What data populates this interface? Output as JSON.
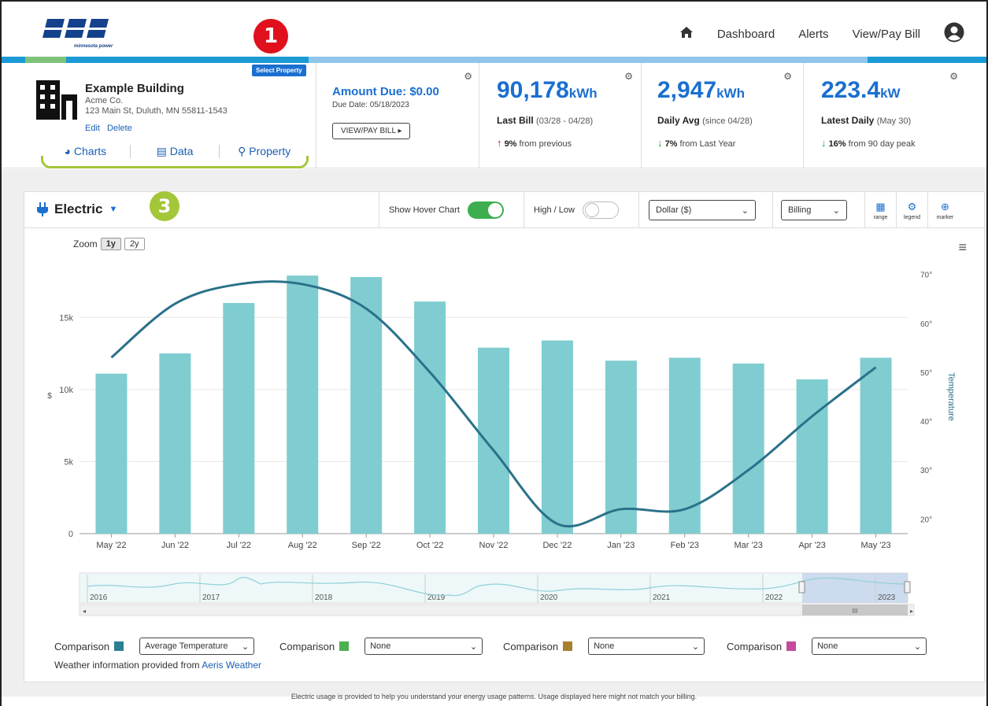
{
  "brand": {
    "logo_text": "minnesota power",
    "accent": "#1a6fd0",
    "callout_red": "#e0101d",
    "callout_green": "#a4c639"
  },
  "nav": {
    "home_icon": "home-icon",
    "items": [
      "Dashboard",
      "Alerts",
      "View/Pay Bill"
    ],
    "profile_icon": "user-circle-icon"
  },
  "callouts": {
    "one": "1",
    "three": "3"
  },
  "property": {
    "select_label": "Select Property",
    "name": "Example Building",
    "company": "Acme Co.",
    "address": "123 Main St, Duluth, MN 55811-1543",
    "edit": "Edit",
    "delete": "Delete",
    "tabs": [
      "Charts",
      "Data",
      "Property"
    ]
  },
  "bill": {
    "amount_due": "Amount Due: $0.00",
    "due_date": "Due Date: 05/18/2023",
    "button": "VIEW/PAY BILL"
  },
  "stats": [
    {
      "value": "90,178",
      "unit": "kWh",
      "label": "Last Bill",
      "paren": "(03/28 - 04/28)",
      "dir": "up",
      "pct": "9%",
      "note": "from previous"
    },
    {
      "value": "2,947",
      "unit": "kWh",
      "label": "Daily Avg",
      "paren": "(since 04/28)",
      "dir": "down",
      "pct": "7%",
      "note": "from Last Year"
    },
    {
      "value": "223.4",
      "unit": "kW",
      "label": "Latest Daily",
      "paren": "(May 30)",
      "dir": "down",
      "pct": "16%",
      "note": "from 90 day peak"
    }
  ],
  "toolbar": {
    "title": "Electric",
    "hover_chart": "Show Hover Chart",
    "hover_chart_on": true,
    "high_low": "High / Low",
    "high_low_on": false,
    "units_select": "Dollar ($)",
    "period_select": "Billing",
    "tools": [
      "range",
      "legend",
      "marker"
    ]
  },
  "zoom": {
    "label": "Zoom",
    "options": [
      "1y",
      "2y"
    ],
    "active": "1y"
  },
  "chart_data": {
    "type": "bar",
    "categories": [
      "May '22",
      "Jun '22",
      "Jul '22",
      "Aug '22",
      "Sep '22",
      "Oct '22",
      "Nov '22",
      "Dec '22",
      "Jan '23",
      "Feb '23",
      "Mar '23",
      "Apr '23",
      "May '23"
    ],
    "series": [
      {
        "values": [
          11100,
          12500,
          16000,
          17900,
          17800,
          16100,
          12900,
          13400,
          12000,
          12200,
          11800,
          10700,
          12200
        ]
      },
      {
        "name": "Temperature",
        "type": "line",
        "axis": "right",
        "values": [
          53,
          64,
          68,
          68,
          63,
          50,
          34,
          19,
          22,
          22,
          30,
          41,
          51
        ]
      }
    ],
    "ylabel": "$",
    "y_ticks": [
      "0",
      "5k",
      "10k",
      "15k"
    ],
    "ylim": [
      0,
      19000
    ],
    "y2label": "Temperature",
    "y2_ticks": [
      "20°",
      "30°",
      "40°",
      "50°",
      "60°",
      "70°"
    ],
    "y2lim": [
      17,
      73
    ],
    "grid": true,
    "colors": {
      "bars": "#7fcdd0",
      "line": "#2a7189"
    }
  },
  "navigator": {
    "years": [
      "2016",
      "2017",
      "2018",
      "2019",
      "2020",
      "2021",
      "2022",
      "2023"
    ],
    "scroll_label": "III"
  },
  "comparisons": [
    {
      "label": "Comparison",
      "color": "#2a7f94",
      "value": "Average Temperature"
    },
    {
      "label": "Comparison",
      "color": "#4caf50",
      "value": "None"
    },
    {
      "label": "Comparison",
      "color": "#a8802e",
      "value": "None"
    },
    {
      "label": "Comparison",
      "color": "#c44a9a",
      "value": "None"
    }
  ],
  "weather": {
    "prefix": "Weather information provided from ",
    "link": "Aeris Weather"
  },
  "footer": "Electric usage is provided to help you understand your energy usage patterns. Usage displayed here might not match your billing."
}
